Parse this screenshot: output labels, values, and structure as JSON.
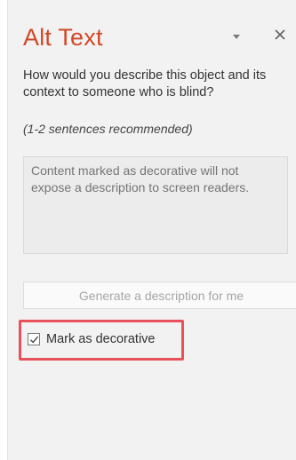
{
  "pane": {
    "title": "Alt Text",
    "options_icon": "dropdown-triangle",
    "close_icon": "x-close"
  },
  "question": "How would you describe this object and its context to someone who is blind?",
  "hint": "(1-2 sentences recommended)",
  "description_field": {
    "value": "",
    "placeholder": "Content marked as decorative will not expose a description to screen readers."
  },
  "generate_button": {
    "label": "Generate a description for me",
    "enabled": false
  },
  "decorative": {
    "label": "Mark as decorative",
    "checked": true
  },
  "colors": {
    "title": "#d24726",
    "highlight": "#e8505a",
    "pane_background": "#f2f2f2"
  }
}
